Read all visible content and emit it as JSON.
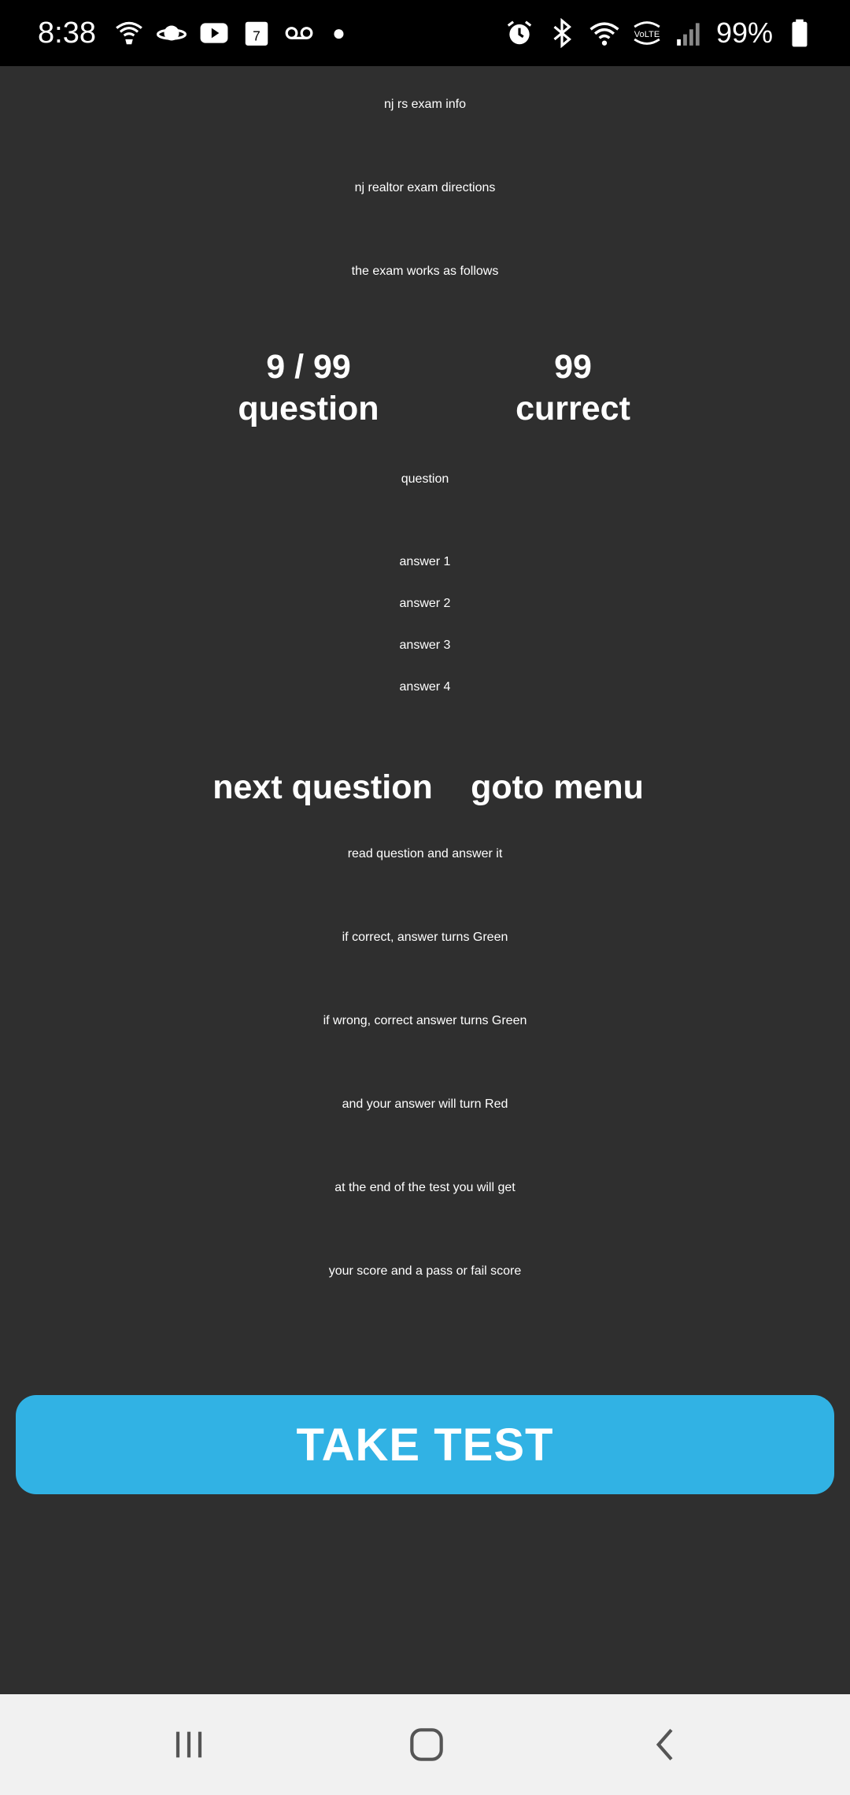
{
  "status_bar": {
    "time": "8:38",
    "battery_percent": "99%",
    "left_icons": [
      "wifi-calling-icon",
      "planet-icon",
      "youtube-icon",
      "calendar-icon",
      "voicemail-icon"
    ],
    "calendar_day": "7",
    "right_icons": [
      "alarm-icon",
      "bluetooth-icon",
      "wifi-icon",
      "volte-icon",
      "signal-icon",
      "battery-icon"
    ],
    "volte_label": "VoLTE"
  },
  "content": {
    "title": "nj rs exam info",
    "subtitle": "nj realtor exam directions",
    "intro": "the exam works as follows",
    "stats": {
      "progress_value": "9 / 99",
      "progress_label": "question",
      "correct_value": "99",
      "correct_label": "currect"
    },
    "question_label": "question",
    "answers": [
      "answer 1",
      "answer 2",
      "answer 3",
      "answer 4"
    ],
    "next_question": "next question",
    "goto_menu": "goto menu",
    "instructions": [
      "read question and answer it",
      "if correct, answer turns Green",
      "if wrong, correct answer turns Green",
      "and your answer will turn Red",
      "at the end of the test you will get",
      "your score and a pass or fail score"
    ]
  },
  "take_test_button": "TAKE TEST",
  "colors": {
    "background": "#2f2f2f",
    "button": "#31b2e4",
    "status_bar": "#000000",
    "nav_bar": "#f1f1f1"
  },
  "nav_bar": {
    "icons": [
      "recent-apps-icon",
      "home-icon",
      "back-icon"
    ]
  }
}
